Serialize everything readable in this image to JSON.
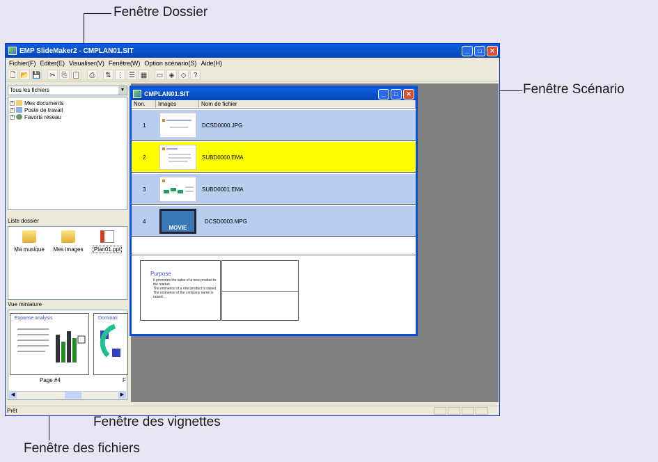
{
  "callouts": {
    "dossier": "Fenêtre Dossier",
    "scenario": "Fenêtre Scénario",
    "vignettes": "Fenêtre des vignettes",
    "fichiers": "Fenêtre des fichiers"
  },
  "window": {
    "title": "EMP SlideMaker2 - CMPLAN01.SIT",
    "menu": [
      "Fichier(F)",
      "Editer(E)",
      "Visualiser(V)",
      "Fenêtre(W)",
      "Option scénario(S)",
      "Aide(H)"
    ],
    "status": "Prêt"
  },
  "folder_panel": {
    "combo_value": "Tous les fichiers",
    "tree": [
      "Mes documents",
      "Poste de travail",
      "Favoris réseau"
    ]
  },
  "file_panel": {
    "label": "Liste dossier",
    "items": [
      "Ma musique",
      "Mes images",
      "Plan01.ppt"
    ]
  },
  "thumb_panel": {
    "label": "Vue miniature",
    "card1_title": "Expanse analysis",
    "card2_title": "Dominati",
    "page_label": "Page #4",
    "page_label_2": "F"
  },
  "scenario": {
    "title": "CMPLAN01.SIT",
    "headers": [
      "Non.",
      "Images",
      "Nom de fichier"
    ],
    "rows": [
      {
        "num": "1",
        "file": "DCSD0000.JPG",
        "color": "#b8cdf0"
      },
      {
        "num": "2",
        "file": "SUBD0000.EMA",
        "color": "#ffff00"
      },
      {
        "num": "3",
        "file": "SUBD0001.EMA",
        "color": "#b8cdf0"
      },
      {
        "num": "4",
        "file": "DCSD0003.MPG",
        "color": "#b8cdf0"
      }
    ],
    "movie_label": "MOVIE",
    "preview_title": "Purpose",
    "preview_bullets": [
      "It promotes the sales of a new product to the market.",
      "The eminence of a new product is raised.",
      "The eminence of the company name is raised."
    ]
  }
}
